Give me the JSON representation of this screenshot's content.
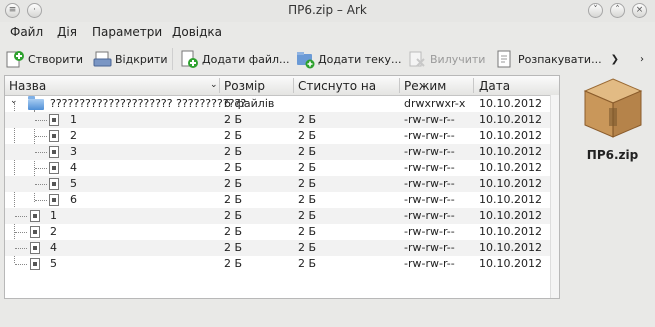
{
  "window": {
    "title": "ПР6.zip – Ark"
  },
  "menu": [
    {
      "label": "Файл"
    },
    {
      "label": "Дія"
    },
    {
      "label": "Параметри"
    },
    {
      "label": "Довідка"
    }
  ],
  "toolbar": {
    "new": "Створити",
    "open": "Відкрити",
    "add_file": "Додати файл...",
    "add_folder": "Додати теку...",
    "delete": "Вилучити",
    "extract": "Розпакувати..."
  },
  "columns": {
    "name": "Назва",
    "size": "Розмір",
    "compressed": "Стиснуто на",
    "mode": "Режим",
    "date": "Дата"
  },
  "rows": [
    {
      "name": "????????????????????? ????????????",
      "size": "6 файлів",
      "compressed": "",
      "mode": "drwxrwxr-x",
      "date": "10.10.2012"
    },
    {
      "name": "1",
      "size": "2 Б",
      "compressed": "2 Б",
      "mode": "-rw-rw-r--",
      "date": "10.10.2012"
    },
    {
      "name": "2",
      "size": "2 Б",
      "compressed": "2 Б",
      "mode": "-rw-rw-r--",
      "date": "10.10.2012"
    },
    {
      "name": "3",
      "size": "2 Б",
      "compressed": "2 Б",
      "mode": "-rw-rw-r--",
      "date": "10.10.2012"
    },
    {
      "name": "4",
      "size": "2 Б",
      "compressed": "2 Б",
      "mode": "-rw-rw-r--",
      "date": "10.10.2012"
    },
    {
      "name": "5",
      "size": "2 Б",
      "compressed": "2 Б",
      "mode": "-rw-rw-r--",
      "date": "10.10.2012"
    },
    {
      "name": "6",
      "size": "2 Б",
      "compressed": "2 Б",
      "mode": "-rw-rw-r--",
      "date": "10.10.2012"
    },
    {
      "name": "1",
      "size": "2 Б",
      "compressed": "2 Б",
      "mode": "-rw-rw-r--",
      "date": "10.10.2012"
    },
    {
      "name": "2",
      "size": "2 Б",
      "compressed": "2 Б",
      "mode": "-rw-rw-r--",
      "date": "10.10.2012"
    },
    {
      "name": "4",
      "size": "2 Б",
      "compressed": "2 Б",
      "mode": "-rw-rw-r--",
      "date": "10.10.2012"
    },
    {
      "name": "5",
      "size": "2 Б",
      "compressed": "2 Б",
      "mode": "-rw-rw-r--",
      "date": "10.10.2012"
    }
  ],
  "side": {
    "archive_name": "ПР6.zip"
  },
  "colors": {
    "folder": "#4f8fd6",
    "box": "#c9975a"
  }
}
